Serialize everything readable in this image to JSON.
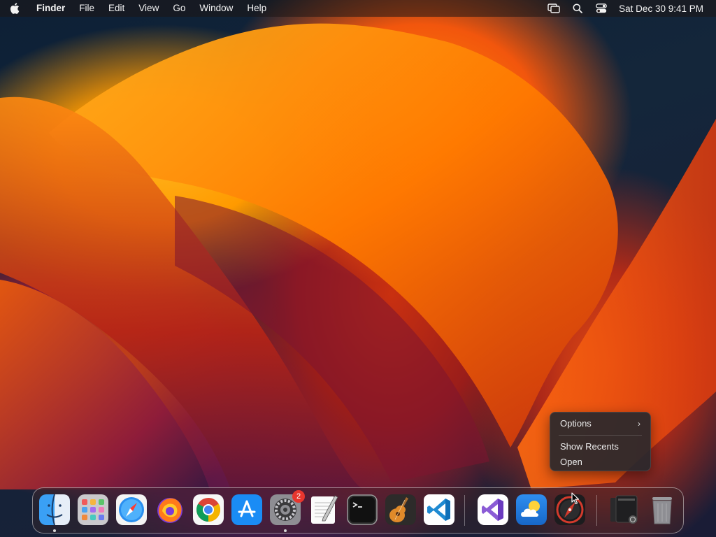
{
  "menubar": {
    "app_name": "Finder",
    "menus": [
      "File",
      "Edit",
      "View",
      "Go",
      "Window",
      "Help"
    ],
    "clock": "Sat Dec 30  9:41 PM",
    "status_icons": [
      "screen-mirroring-icon",
      "search-icon",
      "control-center-icon"
    ]
  },
  "context_menu": {
    "items": [
      "Options",
      "Show Recents",
      "Open"
    ],
    "submenu_arrow": ">"
  },
  "dock": {
    "apps": [
      {
        "name": "Finder",
        "icon": "finder-icon",
        "running": true
      },
      {
        "name": "Launchpad",
        "icon": "launchpad-icon",
        "running": false
      },
      {
        "name": "Safari",
        "icon": "safari-icon",
        "running": false
      },
      {
        "name": "Firefox",
        "icon": "firefox-icon",
        "running": false
      },
      {
        "name": "Google Chrome",
        "icon": "chrome-icon",
        "running": false
      },
      {
        "name": "App Store",
        "icon": "app-store-icon",
        "running": false
      },
      {
        "name": "System Settings",
        "icon": "system-settings-icon",
        "running": true,
        "badge": "2"
      },
      {
        "name": "TextEdit",
        "icon": "textedit-icon",
        "running": false
      },
      {
        "name": "Terminal",
        "icon": "terminal-icon",
        "running": false
      },
      {
        "name": "GarageBand",
        "icon": "garageband-icon",
        "running": false
      },
      {
        "name": "Visual Studio Code",
        "icon": "vscode-icon",
        "running": false
      },
      {
        "name": "Visual Studio",
        "icon": "visual-studio-icon",
        "running": false
      },
      {
        "name": "Weather",
        "icon": "weather-icon",
        "running": false
      },
      {
        "name": "Compass",
        "icon": "compass-icon",
        "running": false
      }
    ],
    "stack": {
      "name": "Downloads stack",
      "icon": "downloads-stack-icon"
    },
    "trash": {
      "name": "Trash",
      "icon": "trash-icon"
    }
  },
  "colors": {
    "menubar_bg": "#1e1614",
    "context_bg": "#28282c",
    "badge": "#e8362e",
    "vscode_blue": "#1f8ad2"
  }
}
